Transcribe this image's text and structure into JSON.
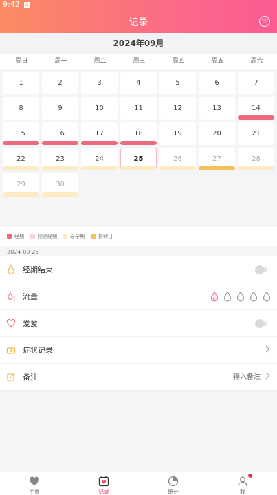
{
  "status_bar": {
    "time": "9:42",
    "badge": "A"
  },
  "header": {
    "title": "记录"
  },
  "calendar": {
    "month_title": "2024年09月",
    "weekdays": [
      "周日",
      "周一",
      "周二",
      "周三",
      "周四",
      "周五",
      "周六"
    ],
    "today": 25,
    "days": [
      "1",
      "2",
      "3",
      "4",
      "5",
      "6",
      "7",
      "8",
      "9",
      "10",
      "11",
      "12",
      "13",
      "14",
      "15",
      "16",
      "17",
      "18",
      "19",
      "20",
      "21",
      "22",
      "23",
      "24",
      "25",
      "26",
      "27",
      "28",
      "29",
      "30"
    ]
  },
  "legend": [
    {
      "label": "经期",
      "color": "#ec6b7e"
    },
    {
      "label": "预测经期",
      "color": "#f9d3da"
    },
    {
      "label": "易孕期",
      "color": "#fdebc4"
    },
    {
      "label": "排卵日",
      "color": "#f2c15b"
    }
  ],
  "selected_date": "2024-09-25",
  "records": {
    "period_end": {
      "label": "经期结束",
      "toggled": false
    },
    "flow": {
      "label": "流量",
      "level": 1,
      "max": 5
    },
    "love": {
      "label": "爱爱",
      "toggled": false
    },
    "symptoms": {
      "label": "症状记录"
    },
    "notes": {
      "label": "备注",
      "placeholder": "输入备注"
    }
  },
  "tabs": [
    {
      "label": "主页",
      "icon": "heart-icon"
    },
    {
      "label": "记录",
      "icon": "calendar-icon",
      "active": true
    },
    {
      "label": "统计",
      "icon": "stats-icon"
    },
    {
      "label": "我",
      "icon": "user-icon",
      "notification": true
    }
  ],
  "colors": {
    "accent": "#fb6b86",
    "period": "#ec6b7e",
    "fertile": "#fdebc4",
    "ovulation": "#f2c15b"
  }
}
